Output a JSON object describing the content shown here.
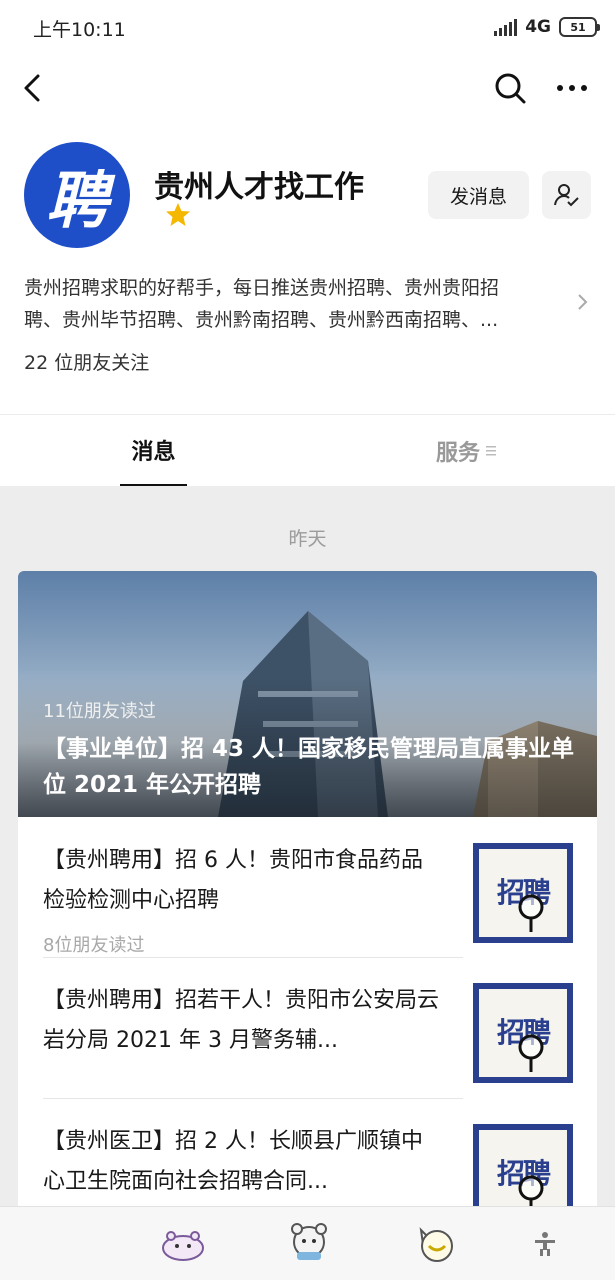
{
  "status_bar": {
    "time": "上午10:11",
    "network": "4G",
    "battery": "51"
  },
  "profile": {
    "avatar_text": "聘",
    "name": "贵州人才找工作",
    "send_message_label": "发消息",
    "description_line1": "贵州招聘求职的好帮手，每日推送贵州招聘、贵州贵阳招",
    "description_line2": "聘、贵州毕节招聘、贵州黔南招聘、贵州黔西南招聘、...",
    "friends_follow": "22 位朋友关注"
  },
  "tabs": {
    "messages": "消息",
    "services": "服务"
  },
  "feed": {
    "date_label": "昨天",
    "cover": {
      "readers": "11位朋友读过",
      "title": "【事业单位】招 43 人！国家移民管理局直属事业单位 2021 年公开招聘"
    },
    "articles": [
      {
        "title": "【贵州聘用】招 6 人！贵阳市食品药品检验检测中心招聘",
        "readers": "8位朋友读过",
        "thumb_text": "招聘"
      },
      {
        "title": "【贵州聘用】招若干人！贵阳市公安局云岩分局 2021 年 3 月警务辅...",
        "readers": "",
        "thumb_text": "招聘"
      },
      {
        "title": "【贵州医卫】招 2 人！长顺县广顺镇中心卫生院面向社会招聘合同...",
        "readers": "",
        "thumb_text": "招聘"
      }
    ]
  },
  "colors": {
    "brand_blue": "#1e4fc9",
    "star": "#f5b800",
    "background": "#ededed"
  }
}
